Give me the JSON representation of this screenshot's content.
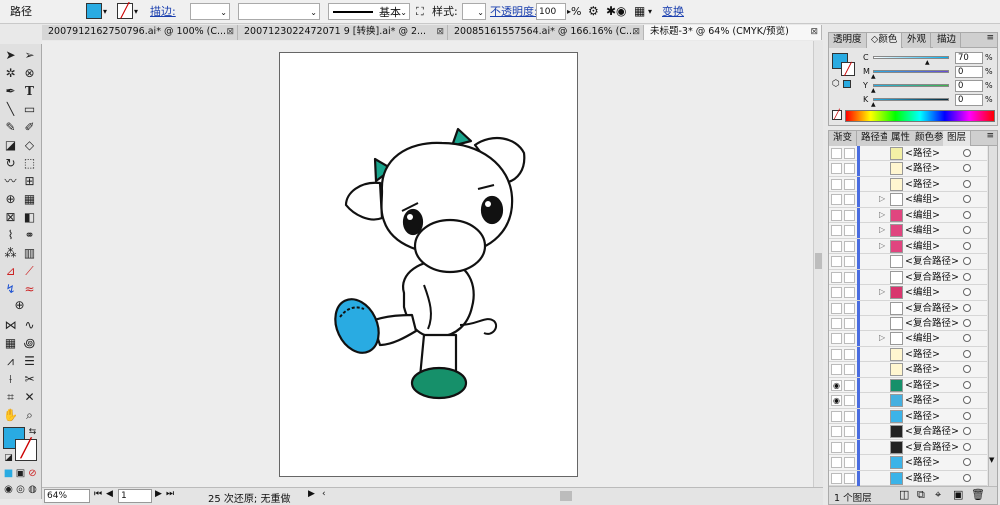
{
  "control_bar": {
    "object_label": "路径",
    "stroke_label": "描边:",
    "stroke_profile": "基本",
    "style_label": "样式:",
    "opacity_label": "不透明度:",
    "opacity_value": "100",
    "percent": "%",
    "transform_label": "变换"
  },
  "document_tabs": [
    {
      "label": "2007912162750796.ai* @ 100% (C..."
    },
    {
      "label": "2007123022472071 9 [转换].ai* @ 2..."
    },
    {
      "label": "20085161557564.ai* @ 166.16% (C..."
    },
    {
      "label": "未标题-3* @ 64% (CMYK/预览)"
    }
  ],
  "color_panel": {
    "tabs": [
      "透明度",
      "颜色",
      "外观",
      "描边"
    ],
    "channels": [
      {
        "name": "C",
        "value": "70"
      },
      {
        "name": "M",
        "value": "0"
      },
      {
        "name": "Y",
        "value": "0"
      },
      {
        "name": "K",
        "value": "0"
      }
    ]
  },
  "layers_panel": {
    "tabs": [
      "渐变",
      "路径查",
      "属性",
      "颜色参",
      "图层"
    ],
    "rows": [
      {
        "name": "<路径>",
        "thumb": "#f3f0a6",
        "tri": ""
      },
      {
        "name": "<路径>",
        "thumb": "#fff6d0",
        "tri": ""
      },
      {
        "name": "<路径>",
        "thumb": "#fff6d0",
        "tri": ""
      },
      {
        "name": "<编组>",
        "thumb": "#ffffff",
        "tri": "▷"
      },
      {
        "name": "<编组>",
        "thumb": "#e0457f",
        "tri": "▷"
      },
      {
        "name": "<编组>",
        "thumb": "#e0457f",
        "tri": "▷"
      },
      {
        "name": "<编组>",
        "thumb": "#e0457f",
        "tri": "▷"
      },
      {
        "name": "<复合路径>",
        "thumb": "#ffffff",
        "tri": ""
      },
      {
        "name": "<复合路径>",
        "thumb": "#ffffff",
        "tri": ""
      },
      {
        "name": "<编组>",
        "thumb": "#d8366e",
        "tri": "▷"
      },
      {
        "name": "<复合路径>",
        "thumb": "#ffffff",
        "tri": ""
      },
      {
        "name": "<复合路径>",
        "thumb": "#ffffff",
        "tri": ""
      },
      {
        "name": "<编组>",
        "thumb": "#ffffff",
        "tri": "▷"
      },
      {
        "name": "<路径>",
        "thumb": "#fff6d0",
        "tri": ""
      },
      {
        "name": "<路径>",
        "thumb": "#fff6d0",
        "tri": ""
      },
      {
        "name": "<路径>",
        "thumb": "#16906a",
        "tri": ""
      },
      {
        "name": "<路径>",
        "thumb": "#45b0e0",
        "tri": ""
      },
      {
        "name": "<路径>",
        "thumb": "#3bb3e8",
        "tri": ""
      },
      {
        "name": "<复合路径>",
        "thumb": "#222222",
        "tri": ""
      },
      {
        "name": "<复合路径>",
        "thumb": "#222222",
        "tri": ""
      },
      {
        "name": "<路径>",
        "thumb": "#3bb3e8",
        "tri": ""
      },
      {
        "name": "<路径>",
        "thumb": "#3bb3e8",
        "tri": ""
      }
    ],
    "footer_label": "1 个图层"
  },
  "status_bar": {
    "zoom": "64%",
    "page": "1",
    "history": "25 次还原; 无重做"
  },
  "colors": {
    "fill": "#29abe2",
    "accent": "#1a3fae",
    "hoof": "#16906a",
    "horn": "#1aa58d",
    "eye": "#111111"
  }
}
